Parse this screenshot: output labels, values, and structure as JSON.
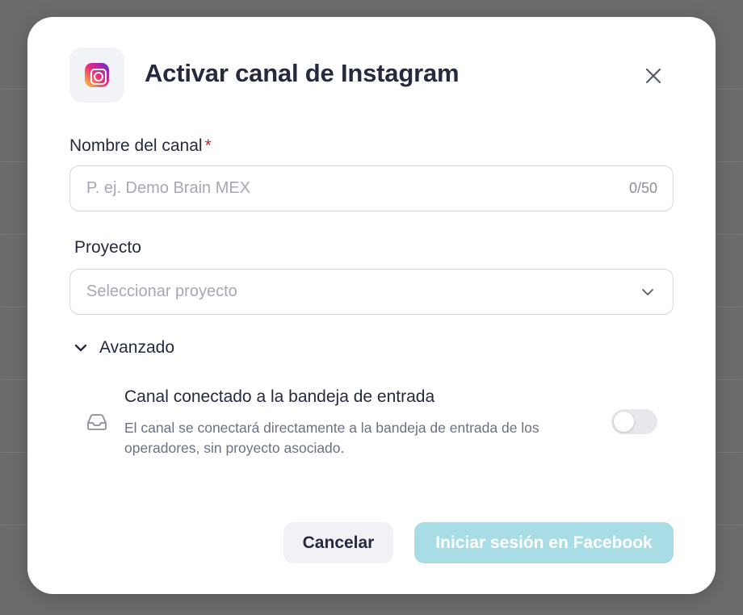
{
  "modal": {
    "title": "Activar canal de Instagram",
    "header_icon": "instagram-logo",
    "close_icon": "close-icon"
  },
  "channel_name": {
    "label": "Nombre del canal",
    "required_mark": "*",
    "placeholder": "P. ej. Demo Brain MEX",
    "value": "",
    "counter": "0/50"
  },
  "project": {
    "label": "Proyecto",
    "placeholder": "Seleccionar proyecto",
    "icon": "chevron-down-icon"
  },
  "advanced": {
    "label": "Avanzado",
    "expanded": true,
    "option": {
      "icon": "inbox-icon",
      "title": "Canal conectado a la bandeja de entrada",
      "description": "El canal se conectará directamente a la bandeja de entrada de los operadores, sin proyecto asociado.",
      "enabled": false
    }
  },
  "footer": {
    "cancel_label": "Cancelar",
    "submit_label": "Iniciar sesión en Facebook"
  },
  "colors": {
    "primary_disabled": "#a9dde5",
    "text": "#262a3f",
    "required": "#c4262e",
    "overlay": "#6b6b6b"
  }
}
